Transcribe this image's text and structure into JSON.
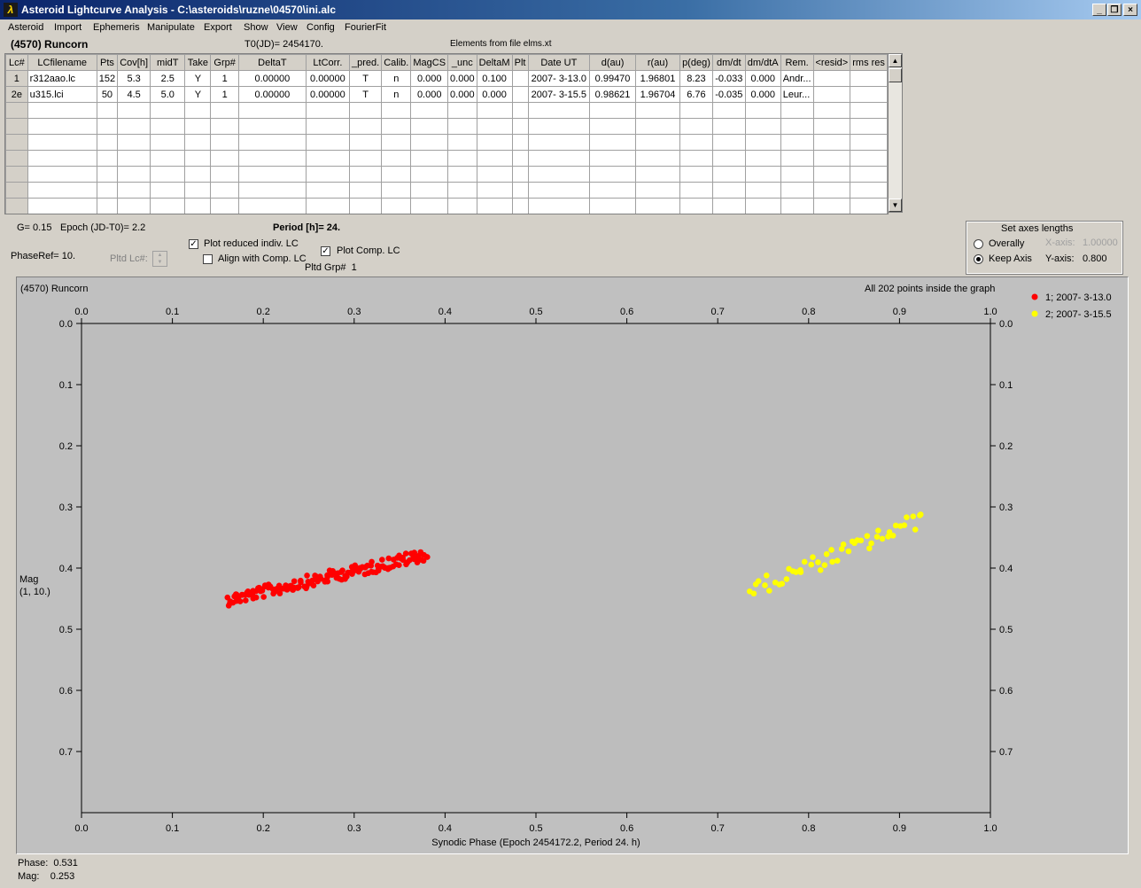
{
  "window": {
    "title": "Asteroid Lightcurve Analysis - C:\\asteroids\\ruzne\\04570\\ini.alc",
    "icon": "app-icon",
    "minimize": "_",
    "restore": "❐",
    "close": "×"
  },
  "menu": [
    "Asteroid",
    "Import",
    "Ephemeris",
    "Manipulate",
    "Export",
    "Show",
    "View",
    "Config",
    "FourierFit"
  ],
  "header": {
    "asteroid": "(4570) Runcorn",
    "t0": "T0(JD)= 2454170.",
    "elements": "Elements from file elms.xt"
  },
  "table": {
    "columns": [
      "Lc#",
      "LCfilename",
      "Pts",
      "Cov[h]",
      "midT",
      "Take",
      "Grp#",
      "DeltaT",
      "LtCorr.",
      "_pred.",
      "Calib.",
      "MagCS",
      "_unc",
      "DeltaM",
      "Plt",
      "Date UT",
      "d(au)",
      "r(au)",
      "p(deg)",
      "dm/dt",
      "dm/dtA",
      "Rem.",
      "<resid>",
      "rms res"
    ],
    "rows": [
      [
        "1",
        "r312aao.lc",
        "152",
        "5.3",
        "2.5",
        "Y",
        "1",
        "0.00000",
        "0.00000",
        "T",
        "n",
        "0.000",
        "0.000",
        "0.100",
        "",
        "2007- 3-13.0",
        "0.99470",
        "1.96801",
        "8.23",
        "-0.033",
        "0.000",
        "Andr...",
        "",
        ""
      ],
      [
        "2e",
        "u315.lci",
        "50",
        "4.5",
        "5.0",
        "Y",
        "1",
        "0.00000",
        "0.00000",
        "T",
        "n",
        "0.000",
        "0.000",
        "0.000",
        "",
        "2007- 3-15.5",
        "0.98621",
        "1.96704",
        "6.76",
        "-0.035",
        "0.000",
        "Leur...",
        "",
        ""
      ]
    ],
    "empty_rows": 7
  },
  "controls": {
    "g_label": "G= 0.15",
    "epoch_label": "Epoch (JD-T0)= 2.2",
    "period_label": "Period [h]= 24.",
    "phaseref_label": "PhaseRef= 10.",
    "pltd_lc_label": "Pltd Lc#:",
    "plot_reduced_label": "Plot reduced indiv. LC",
    "plot_reduced_checked": true,
    "align_label": "Align with Comp. LC",
    "align_checked": false,
    "plot_comp_label": "Plot Comp. LC",
    "plot_comp_checked": true,
    "pltd_grp_label": "Pltd Grp#",
    "pltd_grp_value": "1"
  },
  "axes_box": {
    "title": "Set axes lengths",
    "overally_label": "Overally",
    "keep_axis_label": "Keep Axis",
    "selected": "Keep Axis",
    "x_axis_label": "X-axis:",
    "x_axis_value": "1.00000",
    "y_axis_label": "Y-axis:",
    "y_axis_value": "0.800"
  },
  "plot_info": {
    "title": "(4570) Runcorn",
    "status": "All 202 points inside the graph"
  },
  "status": {
    "phase_label": "Phase:",
    "phase_value": "0.531",
    "mag_label": "Mag:",
    "mag_value": "0.253"
  },
  "chart_data": {
    "type": "scatter",
    "title": "(4570) Runcorn",
    "xlabel": "Synodic Phase (Epoch 2454172.2, Period 24. h)",
    "ylabel": "Mag",
    "ylabel2": "(1, 10.)",
    "xlim": [
      0.0,
      1.0
    ],
    "ylim": [
      0.0,
      0.8
    ],
    "y_inverted": true,
    "x_ticks": [
      "0.0",
      "0.1",
      "0.2",
      "0.3",
      "0.4",
      "0.5",
      "0.6",
      "0.7",
      "0.8",
      "0.9",
      "1.0"
    ],
    "y_ticks": [
      "0.0",
      "0.1",
      "0.2",
      "0.3",
      "0.4",
      "0.5",
      "0.6",
      "0.7"
    ],
    "legend_position": "top-right",
    "series": [
      {
        "name": "1; 2007- 3-13.0",
        "color": "#ff0000",
        "x_range": [
          0.16,
          0.38
        ],
        "y_start": 0.452,
        "y_end": 0.378,
        "count": 152,
        "scatter": 0.01
      },
      {
        "name": "2; 2007- 3-15.5",
        "color": "#ffff00",
        "x_range": [
          0.735,
          0.925
        ],
        "y_start": 0.438,
        "y_end": 0.32,
        "count": 50,
        "scatter": 0.014
      }
    ]
  }
}
